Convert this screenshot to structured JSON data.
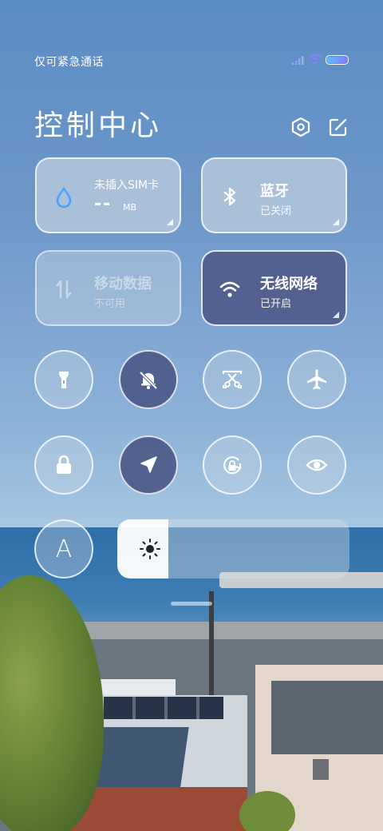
{
  "status_bar": {
    "text": "仅可紧急通话",
    "icons": [
      "signal-icon",
      "wifi-icon",
      "battery-icon"
    ]
  },
  "header": {
    "title": "控制中心",
    "settings_icon": "settings-hexagon-icon",
    "edit_icon": "edit-icon"
  },
  "tiles": {
    "data_usage": {
      "label": "未插入SIM卡",
      "value": "--",
      "unit": "MB",
      "icon": "water-drop-icon"
    },
    "bluetooth": {
      "title": "蓝牙",
      "status": "已关闭",
      "icon": "bluetooth-icon"
    },
    "mobile_data": {
      "title": "移动数据",
      "status": "不可用",
      "icon": "transfer-arrows-icon"
    },
    "wifi": {
      "title": "无线网络",
      "status": "已开启",
      "icon": "wifi-icon"
    }
  },
  "toggles": [
    {
      "name": "flashlight",
      "icon": "flashlight-icon",
      "active": false
    },
    {
      "name": "mute",
      "icon": "bell-off-icon",
      "active": true
    },
    {
      "name": "screenshot",
      "icon": "scissors-icon",
      "active": false
    },
    {
      "name": "airplane-mode",
      "icon": "airplane-icon",
      "active": false
    },
    {
      "name": "lock-screen",
      "icon": "lock-icon",
      "active": false
    },
    {
      "name": "location",
      "icon": "location-arrow-icon",
      "active": true
    },
    {
      "name": "auto-rotate",
      "icon": "rotate-lock-icon",
      "active": false
    },
    {
      "name": "reading-mode",
      "icon": "eye-icon",
      "active": false
    },
    {
      "name": "auto-brightness",
      "icon": "letter-a-icon",
      "label": "A",
      "active": false
    }
  ],
  "brightness": {
    "icon": "sun-icon",
    "level": 0.22
  },
  "colors": {
    "active_tile": "#505e8c",
    "tile_light": "#dce1e6",
    "battery_gradient_start": "#56c1ff",
    "battery_gradient_end": "#8b7bff"
  }
}
